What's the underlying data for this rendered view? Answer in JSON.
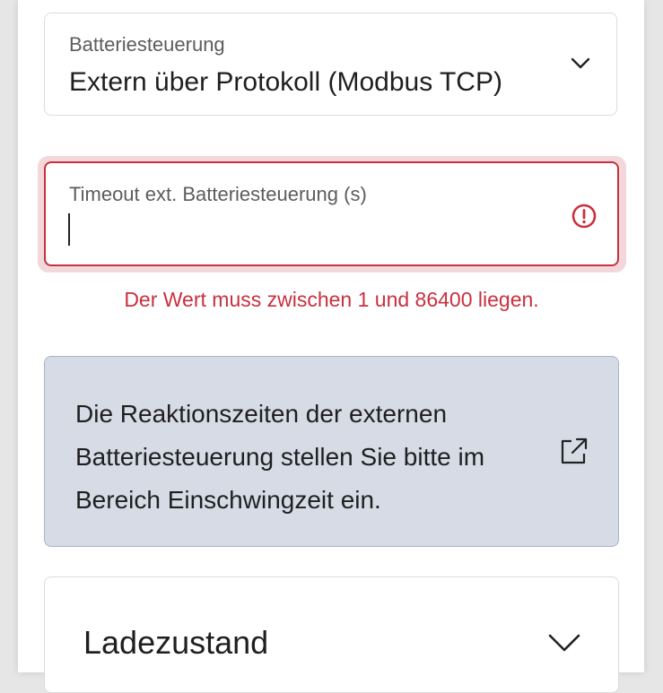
{
  "battery_control": {
    "label": "Batteriesteuerung",
    "value": "Extern über Protokoll (Modbus TCP)",
    "icon": "chevron-down-icon"
  },
  "timeout_field": {
    "label": "Timeout ext. Batteriesteuerung (s)",
    "value": "",
    "error_icon": "error-icon",
    "error_message": "Der Wert muss zwischen 1 und 86400 liegen."
  },
  "info": {
    "text": "Die Reaktionszeiten der externen Batteriesteuerung stellen Sie bitte im Bereich Einschwingzeit ein.",
    "icon": "external-link-icon"
  },
  "state_of_charge": {
    "title": "Ladezustand",
    "icon": "chevron-down-icon"
  },
  "colors": {
    "error": "#c8313f",
    "error_glow": "#f3d8db",
    "info_bg": "#d6dbe6",
    "info_border": "#a9b4c9",
    "text": "#1f1f1f",
    "label": "#5c5c5c"
  }
}
